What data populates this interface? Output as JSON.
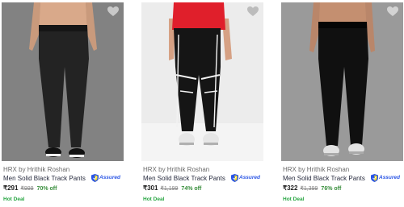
{
  "products": [
    {
      "brand": "HRX by Hrithik Roshan",
      "title": "Men Solid Black Track Pants",
      "assured_label": "Assured",
      "price": "₹291",
      "mrp": "₹999",
      "discount": "70% off",
      "deal": "Hot Deal"
    },
    {
      "brand": "HRX by Hrithik Roshan",
      "title": "Men Solid Black Track Pants",
      "assured_label": "Assured",
      "price": "₹301",
      "mrp": "₹1,199",
      "discount": "74% off",
      "deal": "Hot Deal"
    },
    {
      "brand": "HRX by Hrithik Roshan",
      "title": "Men Solid Black Track Pants",
      "assured_label": "Assured",
      "price": "₹322",
      "mrp": "₹1,399",
      "discount": "76% off",
      "deal": "Hot Deal"
    }
  ],
  "colors": {
    "brand_text": "#6b6b6b",
    "title_text": "#282c3f",
    "assured_blue": "#2a55e5",
    "discount_green": "#388e3c",
    "deal_green": "#26a541"
  },
  "icons": {
    "wishlist": "heart-icon",
    "assured": "shield-icon"
  }
}
